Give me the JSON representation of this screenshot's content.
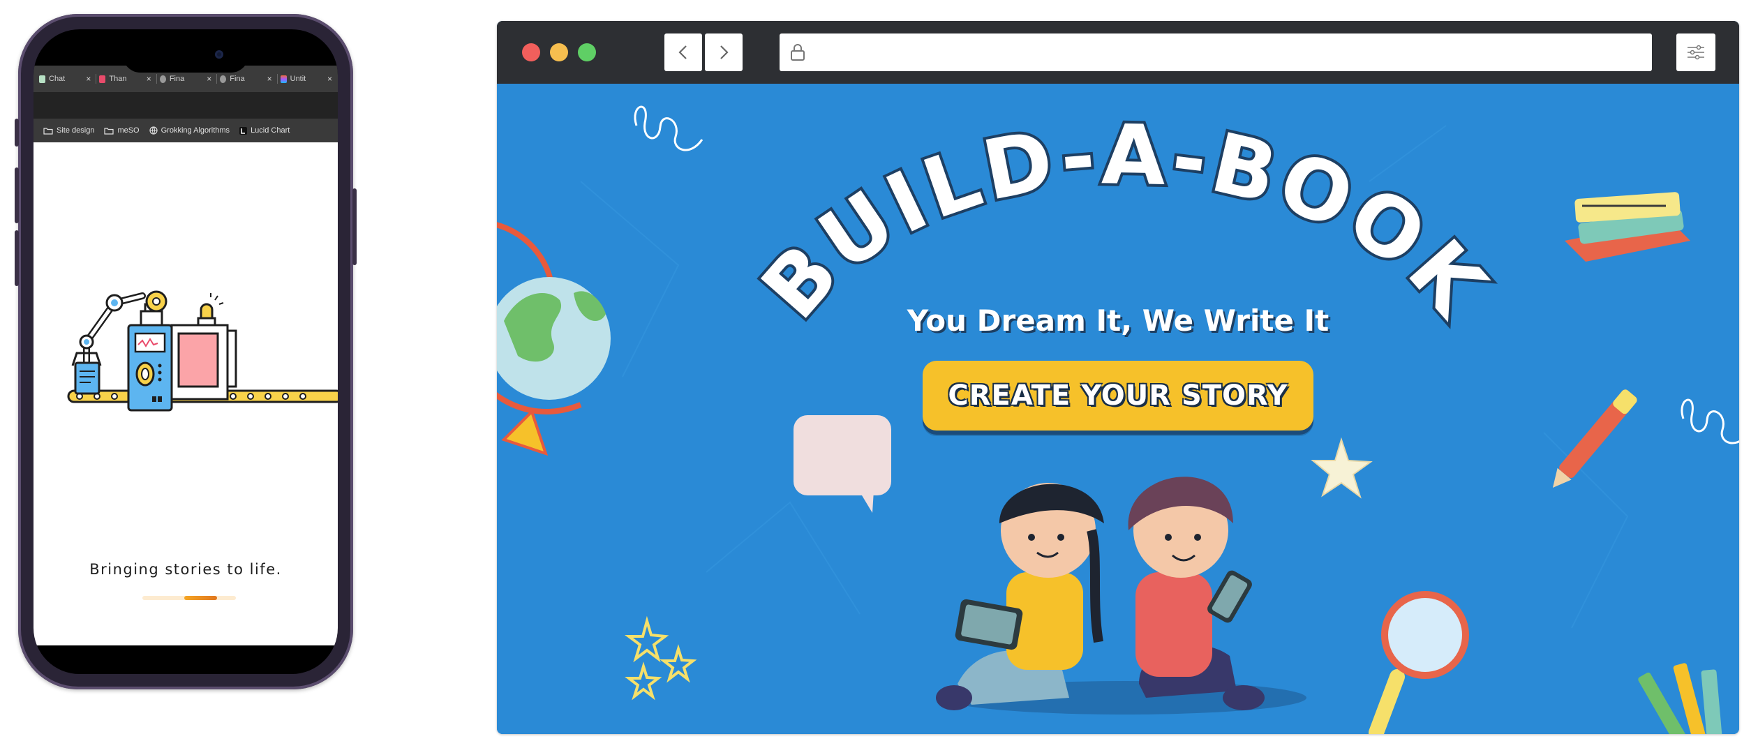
{
  "phone": {
    "tabs": [
      {
        "label": "Chat",
        "close": "×",
        "favicon_color": "#b7e0c4"
      },
      {
        "label": "Than",
        "close": "×",
        "favicon_color": "#e94b6b"
      },
      {
        "label": "Fina",
        "close": "×",
        "favicon_color": "#9a9a9a"
      },
      {
        "label": "Fina",
        "close": "×",
        "favicon_color": "#9a9a9a"
      },
      {
        "label": "Untit",
        "close": "×",
        "favicon_color": "#f26b3a"
      }
    ],
    "bookmarks": [
      {
        "label": "Site design",
        "icon": "folder-icon"
      },
      {
        "label": "meSO",
        "icon": "folder-icon"
      },
      {
        "label": "Grokking Algorithms",
        "icon": "globe-icon"
      },
      {
        "label": "Lucid Chart",
        "icon": "lucid-icon"
      }
    ],
    "loading_text": "Bringing stories to life.",
    "progress": 0.35,
    "illustration": "robot-factory-illustration"
  },
  "browser": {
    "traffic_lights": [
      "#f25f5c",
      "#f6be4f",
      "#5fcf65"
    ],
    "url": "",
    "hero": {
      "title": "BUILD-A-BOOK",
      "subtitle": "You Dream It, We Write It",
      "cta_label": "CREATE YOUR STORY",
      "colors": {
        "background": "#2a8ad6",
        "cta": "#f6c12a",
        "title_outline": "#1d3f63"
      }
    }
  }
}
